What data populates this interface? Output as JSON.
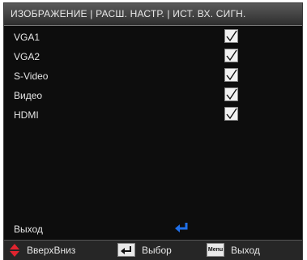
{
  "title": "ИЗОБРАЖЕНИЕ | РАСШ. НАСТР. | ИСТ. ВХ. СИГН.",
  "sources": [
    {
      "label": "VGA1",
      "checked": true
    },
    {
      "label": "VGA2",
      "checked": true
    },
    {
      "label": "S-Video",
      "checked": true
    },
    {
      "label": "Видео",
      "checked": true
    },
    {
      "label": "HDMI",
      "checked": true
    }
  ],
  "exit_label": "Выход",
  "footer": {
    "updown_label": "ВверхВниз",
    "enter_label": "Выбор",
    "menu_key": "Menu",
    "menu_label": "Выход"
  },
  "colors": {
    "accent_enter": "#1f6fe8",
    "arrow_red": "#e0242f"
  }
}
